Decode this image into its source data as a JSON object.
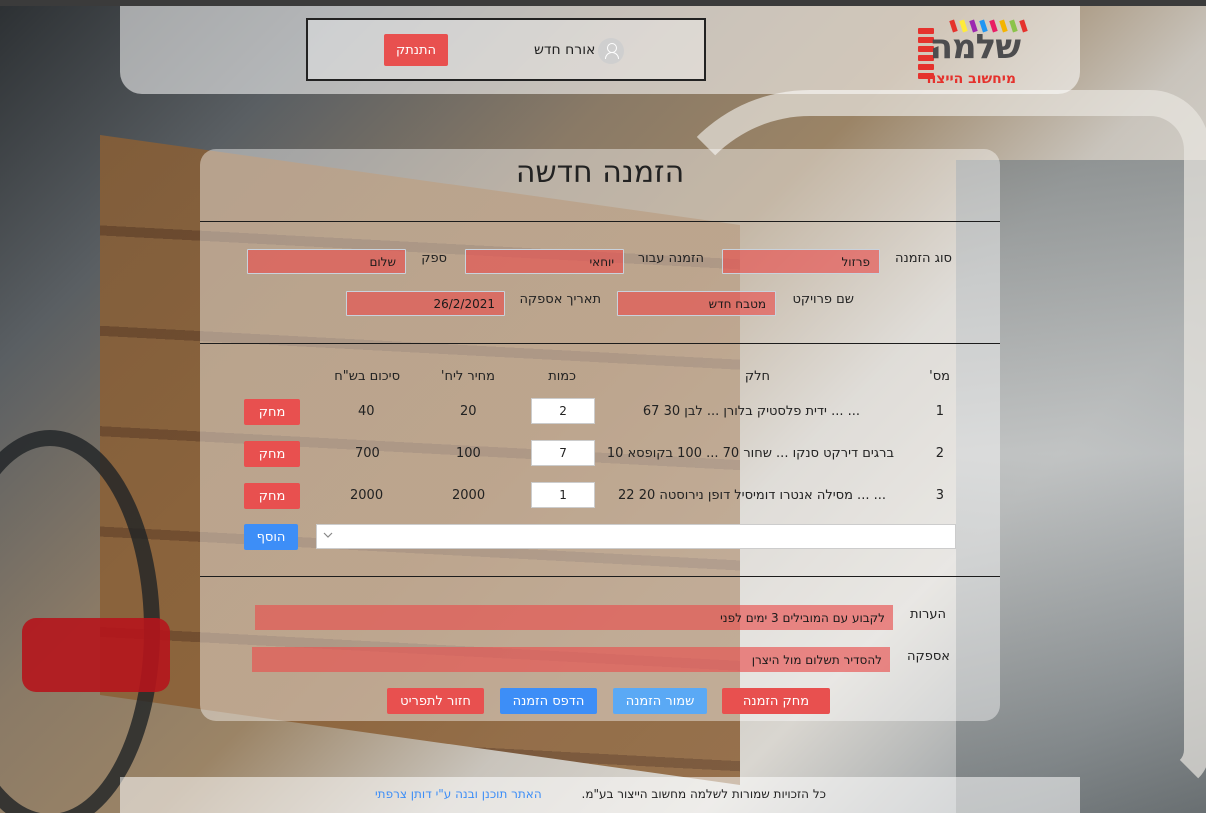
{
  "header": {
    "logo_main": "שלמה",
    "logo_sub": "מיחשוב הייצור",
    "user_name": "אורח חדש",
    "logout_label": "התנתק"
  },
  "order": {
    "title": "הזמנה חדשה",
    "order_type_label": "סוג הזמנה",
    "order_type_value": "פרזול",
    "order_for_label": "הזמנה עבור",
    "order_for_value": "יוחאי",
    "supplier_label": "ספק",
    "supplier_value": "שלום",
    "project_label": "שם פרויקט",
    "project_value": "מטבח חדש",
    "delivery_date_label": "תאריך אספקה",
    "delivery_date_value": "26/2/2021"
  },
  "table": {
    "headers": {
      "num": "מס'",
      "part": "חלק",
      "qty": "כמות",
      "price": "מחיר ליח'",
      "total": "סיכום בש\"ח"
    },
    "rows": [
      {
        "num": "1",
        "part": "... ... ידית פלסטיק בלורן ... לבן 30 67",
        "qty": "2",
        "price": "20",
        "total": "40",
        "delete_label": "מחק"
      },
      {
        "num": "2",
        "part": "ברגים דירקט סנקו ... שחור 70 ... 100 בקופסא 10",
        "qty": "7",
        "price": "100",
        "total": "700",
        "delete_label": "מחק"
      },
      {
        "num": "3",
        "part": "... ... מסילה אנטרו דומיסיל דופן נירוסטה 20 22",
        "qty": "1",
        "price": "2000",
        "total": "2000",
        "delete_label": "מחק"
      }
    ],
    "add_label": "הוסף",
    "part_select_value": ""
  },
  "notes": {
    "remarks_label": "הערות",
    "remarks_value": "לקבוע עם המובילים 3 ימים לפני",
    "delivery_label": "אספקה",
    "delivery_value": "להסדיר תשלום מול היצרן"
  },
  "actions": {
    "delete_order": "מחק הזמנה",
    "save_order": "שמור הזמנה",
    "print_order": "הדפס הזמנה",
    "back_to_menu": "חזור לתפריט"
  },
  "footer": {
    "copyright": "כל הזכויות שמורות לשלמה מחשוב הייצור בע\"מ.",
    "credit": "האתר תוכנן ובנה ע\"י דותן צרפתי"
  },
  "colors": {
    "danger": "#e8504f",
    "primary": "#3d8ef7",
    "primary_light": "#5aa9f5"
  }
}
